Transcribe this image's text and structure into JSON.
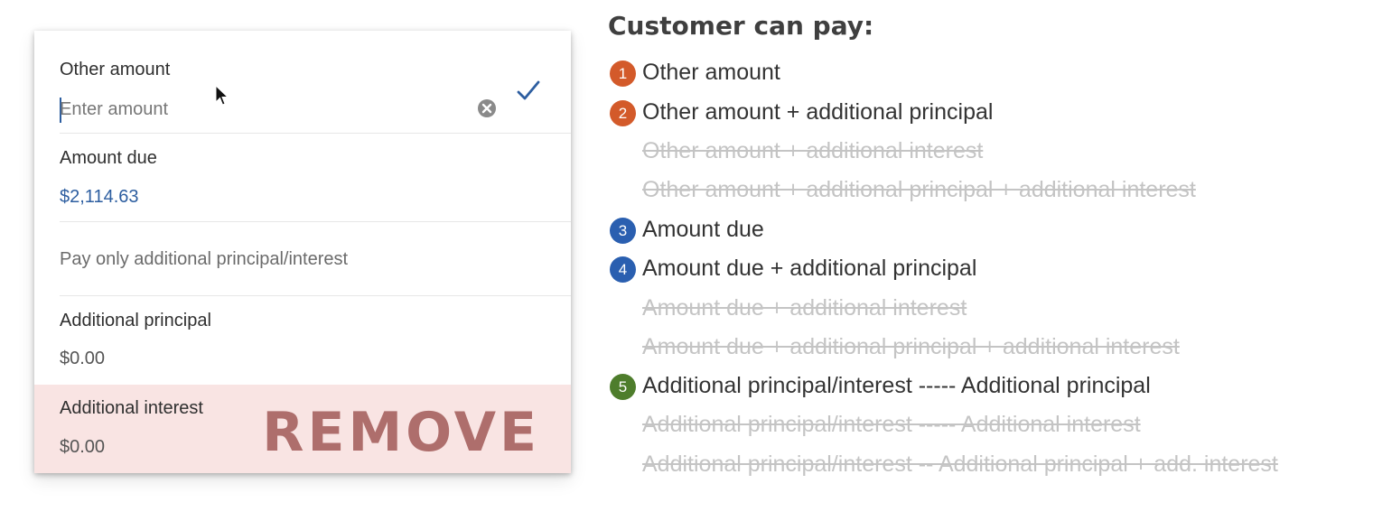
{
  "card": {
    "other_amount_label": "Other amount",
    "enter_amount_placeholder": "Enter amount",
    "amount_due_label": "Amount due",
    "amount_due_value": "$2,114.63",
    "pay_only_label": "Pay only additional principal/interest",
    "additional_principal_label": "Additional principal",
    "additional_principal_value": "$0.00",
    "additional_interest_label": "Additional interest",
    "additional_interest_value": "$0.00",
    "remove_label": "REMOVE",
    "icons": [
      "clear-icon",
      "check-icon",
      "cursor-icon"
    ],
    "colors": {
      "accent": "#2d5ea0",
      "remove_band": "#f9e4e3",
      "remove_text": "#ae6e6c"
    }
  },
  "options": {
    "heading": "Customer can pay:",
    "items": [
      {
        "badge": "1",
        "text": "Other amount",
        "struck": false,
        "color": "#d35a2a"
      },
      {
        "badge": "2",
        "text": "Other amount + additional principal",
        "struck": false,
        "color": "#d35a2a"
      },
      {
        "badge": "",
        "text": "Other amount + additional interest",
        "struck": true
      },
      {
        "badge": "",
        "text": "Other amount +  additional principal + additional interest",
        "struck": true
      },
      {
        "badge": "3",
        "text": "Amount due",
        "struck": false,
        "color": "#2a5fb0"
      },
      {
        "badge": "4",
        "text": "Amount due + additional principal",
        "struck": false,
        "color": "#2a5fb0"
      },
      {
        "badge": "",
        "text": "Amount due + additional interest",
        "struck": true
      },
      {
        "badge": "",
        "text": "Amount due +  additional principal + additional interest",
        "struck": true
      },
      {
        "badge": "5",
        "text": "Additional principal/interest ----- Additional principal",
        "struck": false,
        "color": "#4e7d2c"
      },
      {
        "badge": "",
        "text": "Additional principal/interest ----- Additional interest",
        "struck": true
      },
      {
        "badge": "",
        "text": "Additional principal/interest -- Additional principal + add. interest",
        "struck": true
      }
    ]
  }
}
